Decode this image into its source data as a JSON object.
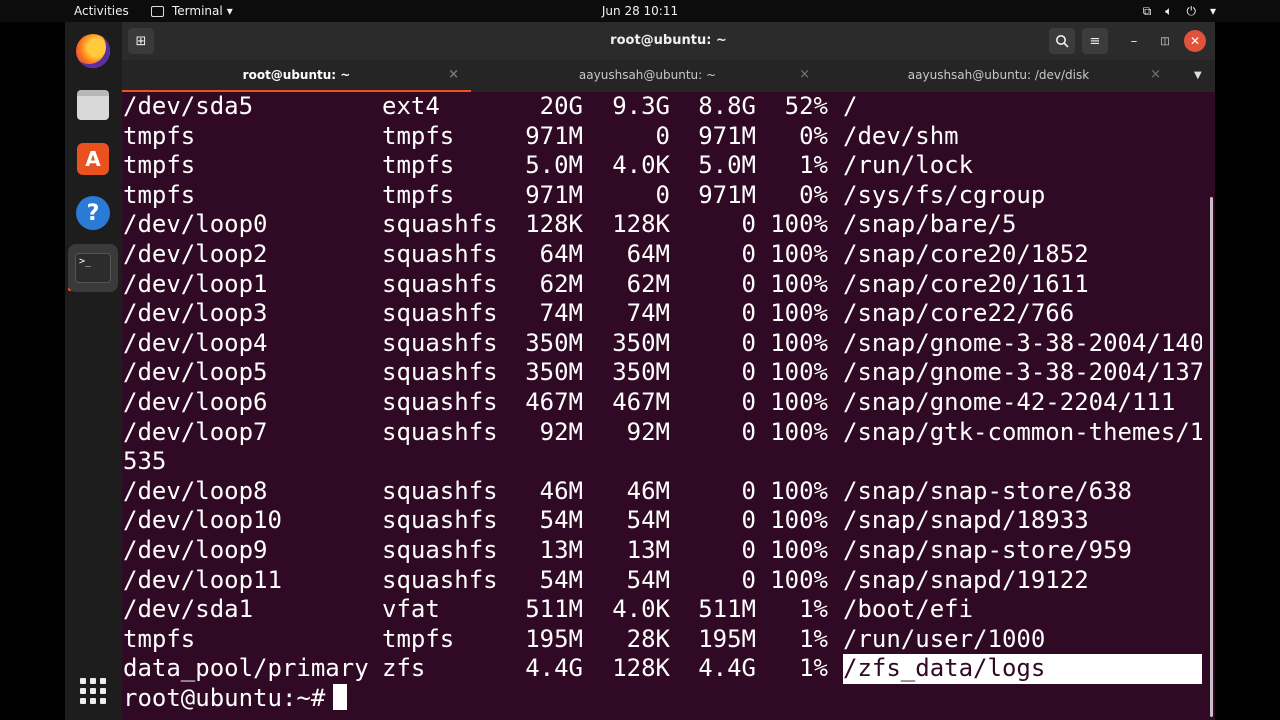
{
  "topbar": {
    "activities": "Activities",
    "app_name": "Terminal",
    "app_menu_arrow": "▾",
    "clock": "Jun 28  10:11",
    "tray_icons": [
      "network-icon",
      "volume-icon",
      "power-icon",
      "chevron-down-icon"
    ]
  },
  "dock": {
    "items": [
      "firefox-icon",
      "files-icon",
      "software-icon",
      "help-icon",
      "terminal-icon",
      "show-apps-icon"
    ],
    "help_glyph": "?",
    "software_glyph": "A",
    "terminal_glyph": ">_"
  },
  "window": {
    "title": "root@ubuntu: ~",
    "tabs": [
      {
        "label": "root@ubuntu: ~",
        "active": true
      },
      {
        "label": "aayushsah@ubuntu: ~",
        "active": false
      },
      {
        "label": "aayushsah@ubuntu: /dev/disk",
        "active": false
      }
    ],
    "tab_close": "×"
  },
  "terminal": {
    "rows": [
      [
        "/dev/sda5",
        "ext4",
        "20G",
        "9.3G",
        "8.8G",
        "52%",
        "/"
      ],
      [
        "tmpfs",
        "tmpfs",
        "971M",
        "0",
        "971M",
        "0%",
        "/dev/shm"
      ],
      [
        "tmpfs",
        "tmpfs",
        "5.0M",
        "4.0K",
        "5.0M",
        "1%",
        "/run/lock"
      ],
      [
        "tmpfs",
        "tmpfs",
        "971M",
        "0",
        "971M",
        "0%",
        "/sys/fs/cgroup"
      ],
      [
        "/dev/loop0",
        "squashfs",
        "128K",
        "128K",
        "0",
        "100%",
        "/snap/bare/5"
      ],
      [
        "/dev/loop2",
        "squashfs",
        "64M",
        "64M",
        "0",
        "100%",
        "/snap/core20/1852"
      ],
      [
        "/dev/loop1",
        "squashfs",
        "62M",
        "62M",
        "0",
        "100%",
        "/snap/core20/1611"
      ],
      [
        "/dev/loop3",
        "squashfs",
        "74M",
        "74M",
        "0",
        "100%",
        "/snap/core22/766"
      ],
      [
        "/dev/loop4",
        "squashfs",
        "350M",
        "350M",
        "0",
        "100%",
        "/snap/gnome-3-38-2004/140"
      ],
      [
        "/dev/loop5",
        "squashfs",
        "350M",
        "350M",
        "0",
        "100%",
        "/snap/gnome-3-38-2004/137"
      ],
      [
        "/dev/loop6",
        "squashfs",
        "467M",
        "467M",
        "0",
        "100%",
        "/snap/gnome-42-2204/111"
      ],
      [
        "/dev/loop7",
        "squashfs",
        "92M",
        "92M",
        "0",
        "100%",
        "/snap/gtk-common-themes/1"
      ],
      [
        "535",
        "",
        "",
        "",
        "",
        "",
        ""
      ],
      [
        "/dev/loop8",
        "squashfs",
        "46M",
        "46M",
        "0",
        "100%",
        "/snap/snap-store/638"
      ],
      [
        "/dev/loop10",
        "squashfs",
        "54M",
        "54M",
        "0",
        "100%",
        "/snap/snapd/18933"
      ],
      [
        "/dev/loop9",
        "squashfs",
        "13M",
        "13M",
        "0",
        "100%",
        "/snap/snap-store/959"
      ],
      [
        "/dev/loop11",
        "squashfs",
        "54M",
        "54M",
        "0",
        "100%",
        "/snap/snapd/19122"
      ],
      [
        "/dev/sda1",
        "vfat",
        "511M",
        "4.0K",
        "511M",
        "1%",
        "/boot/efi"
      ],
      [
        "tmpfs",
        "tmpfs",
        "195M",
        "28K",
        "195M",
        "1%",
        "/run/user/1000"
      ],
      [
        "data_pool/primary",
        "zfs",
        "4.4G",
        "128K",
        "4.4G",
        "1%",
        "/zfs_data/logs"
      ]
    ],
    "highlighted_row": 19,
    "prompt": "root@ubuntu:~#"
  },
  "colors": {
    "terminal_bg": "#300a24",
    "accent": "#e95420",
    "close_button": "#e0533a"
  }
}
